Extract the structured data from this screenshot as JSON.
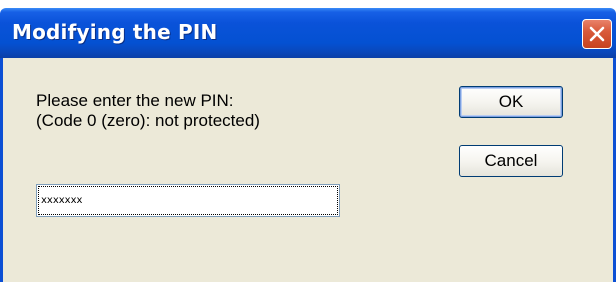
{
  "window": {
    "title": "Modifying the PIN",
    "close_icon": "close-icon"
  },
  "prompt": {
    "line1": "Please enter the new PIN:",
    "line2": "(Code 0 (zero): not protected)"
  },
  "pin_field": {
    "value": "xxxxxxx"
  },
  "buttons": {
    "ok_label": "OK",
    "cancel_label": "Cancel"
  },
  "colors": {
    "titlebar": "#0451d2",
    "dialog_bg": "#ece9d8",
    "close_button": "#d95a3b"
  }
}
